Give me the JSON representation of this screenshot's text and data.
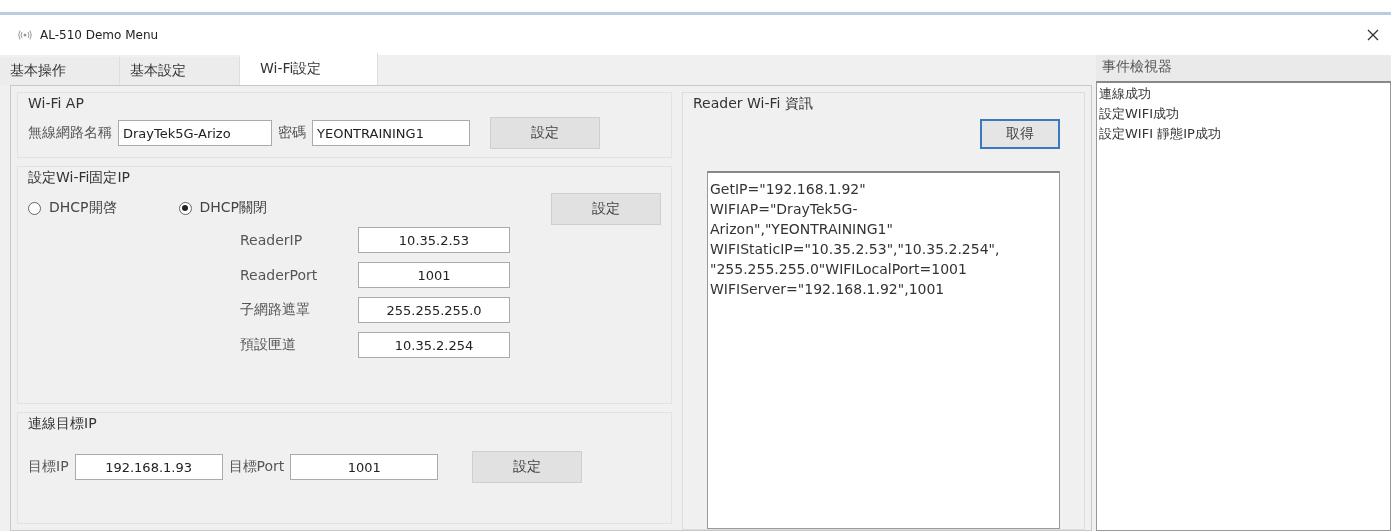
{
  "window": {
    "title": "AL-510 Demo Menu"
  },
  "tabs": [
    {
      "label": "基本操作",
      "selected": false
    },
    {
      "label": "基本設定",
      "selected": false
    },
    {
      "label": "Wi-Fi設定",
      "selected": true
    }
  ],
  "wifi_ap": {
    "title": "Wi-Fi AP",
    "ssid_label": "無線網路名稱",
    "ssid": "DrayTek5G-Arizo",
    "password_label": "密碼",
    "password": "YEONTRAINING1",
    "button": "設定"
  },
  "static_ip": {
    "title": "設定Wi-Fi固定IP",
    "radios": [
      {
        "label": "DHCP開啓",
        "selected": false
      },
      {
        "label": "DHCP關閉",
        "selected": true
      }
    ],
    "button": "設定",
    "fields": [
      {
        "label": "ReaderIP",
        "value": "10.35.2.53"
      },
      {
        "label": "ReaderPort",
        "value": "1001"
      },
      {
        "label": "子網路遮罩",
        "value": "255.255.255.0"
      },
      {
        "label": "預設匣道",
        "value": "10.35.2.254"
      }
    ]
  },
  "target": {
    "title": "連線目標IP",
    "ip_label": "目標IP",
    "ip": "192.168.1.93",
    "port_label": "目標Port",
    "port": "1001",
    "button": "設定"
  },
  "reader_info": {
    "title": "Reader Wi-Fi 資訊",
    "button": "取得",
    "lines": [
      "GetIP=\"192.168.1.92\"",
      "WIFIAP=\"DrayTek5G-",
      "Arizon\",\"YEONTRAINING1\"",
      "WIFIStaticIP=\"10.35.2.53\",\"10.35.2.254\",",
      "\"255.255.255.0\"WIFILocalPort=1001",
      "WIFIServer=\"192.168.1.92\",1001"
    ]
  },
  "event_viewer": {
    "title": "事件檢視器",
    "events": [
      "連線成功",
      "設定WIFI成功",
      "設定WIFI 靜態IP成功"
    ]
  }
}
